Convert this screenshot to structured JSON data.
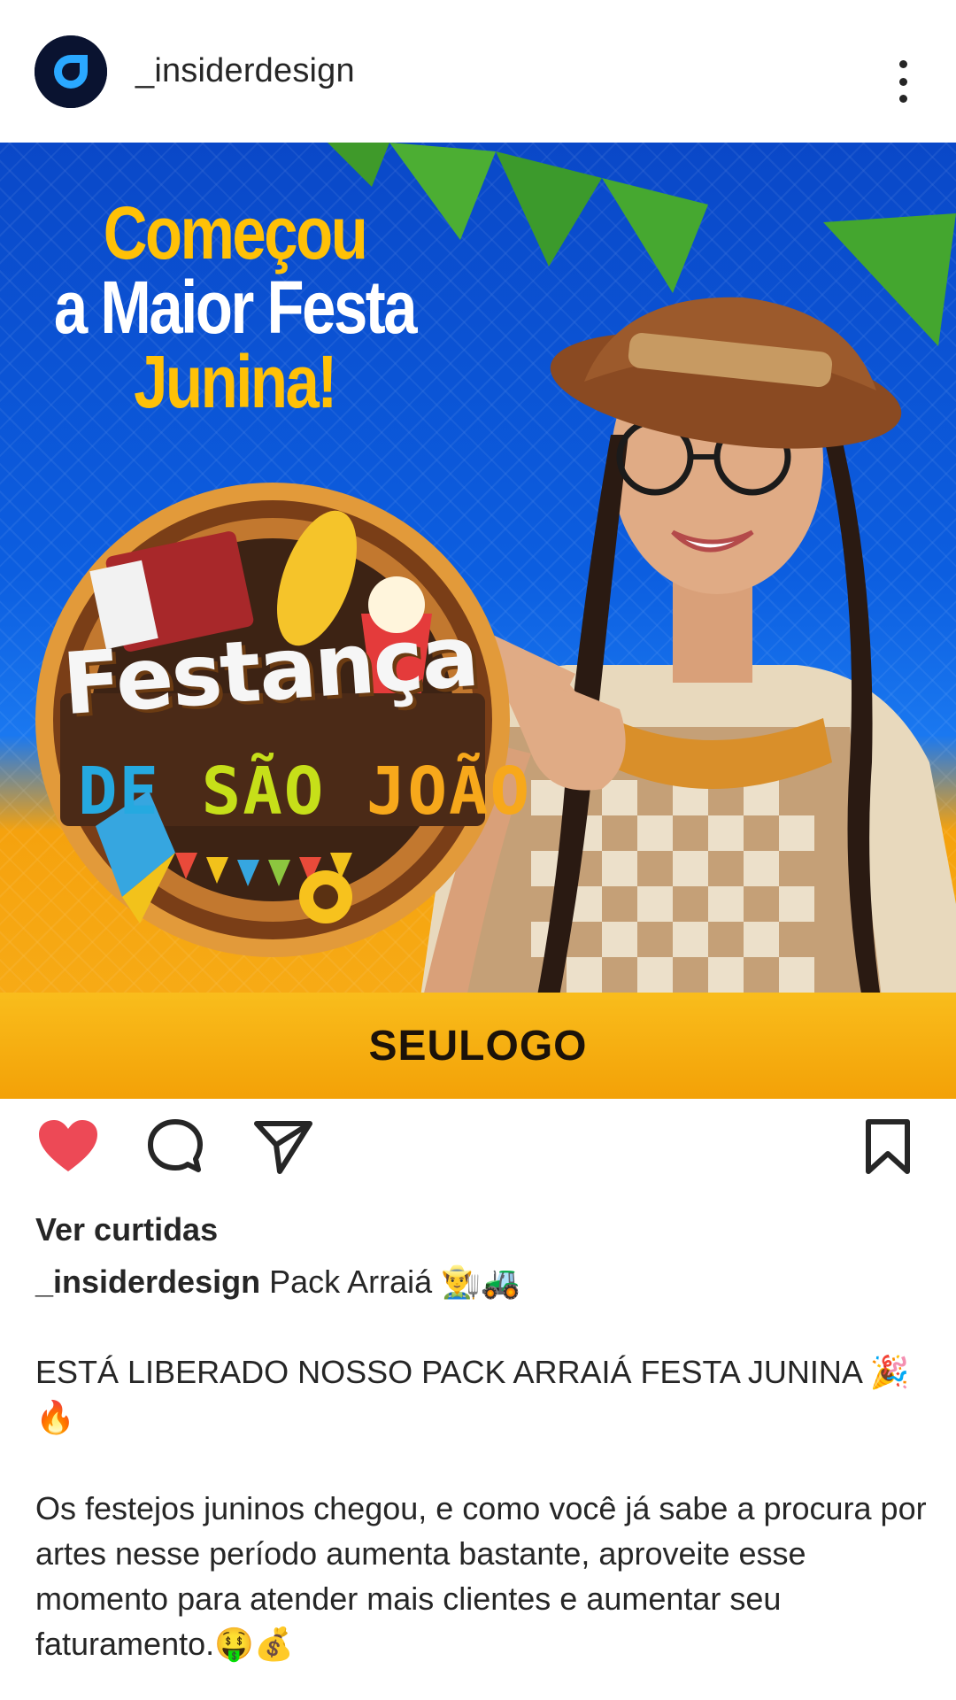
{
  "header": {
    "username": "_insiderdesign",
    "avatar_icon": "insider-logo-icon",
    "more_icon": "more-vertical-icon"
  },
  "post": {
    "headline_line1": "Começou",
    "headline_line2": "a Maior Festa",
    "headline_line3": "Junina!",
    "badge_title": "Festança",
    "badge_sub_1": "DE",
    "badge_sub_2": "SÃO",
    "badge_sub_3": "JOÃO",
    "logo": "SEULOGO",
    "colors": {
      "blue": "#0c5ee0",
      "yellow": "#ffc107",
      "orange": "#f5a20e"
    }
  },
  "actions": {
    "like_icon": "heart-filled-icon",
    "comment_icon": "comment-icon",
    "share_icon": "send-icon",
    "save_icon": "bookmark-icon",
    "like_color": "#ed4956"
  },
  "likes_text": "Ver curtidas",
  "caption": {
    "username": "_insiderdesign",
    "title": "Pack Arraiá 👨‍🌾🚜",
    "paragraph1": "ESTÁ LIBERADO NOSSO PACK ARRAIÁ FESTA JUNINA 🎉🔥",
    "paragraph2": "Os festejos juninos chegou, e como você já sabe a procura por artes nesse período aumenta bastante, aproveite esse momento para atender mais clientes e aumentar seu faturamento.🤑💰"
  }
}
